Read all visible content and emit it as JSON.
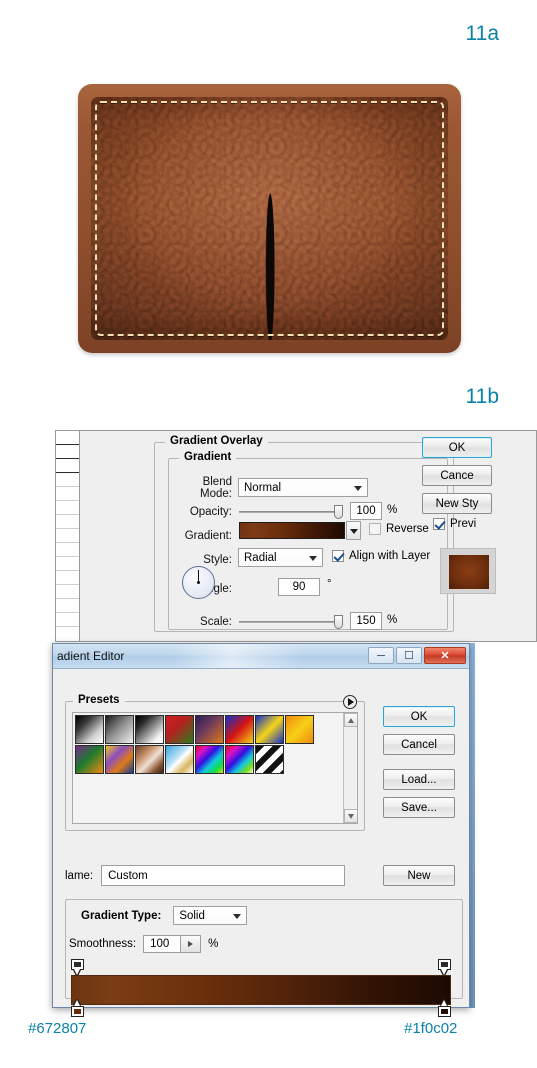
{
  "steps": {
    "a_label": "11a",
    "b_label": "11b"
  },
  "artwork": {
    "name": "leather-wallet-preview",
    "base_color": "#94502b",
    "stitch_color": "#efe1b4",
    "slot_color": "#0c0805"
  },
  "layer_style_dialog": {
    "section_title": "Gradient Overlay",
    "group_title": "Gradient",
    "blend_mode": {
      "label": "Blend Mode:",
      "value": "Normal"
    },
    "opacity": {
      "label": "Opacity:",
      "value": "100",
      "unit": "%"
    },
    "gradient": {
      "label": "Gradient:",
      "swatch_from": "#723312",
      "swatch_to": "#1d0b02"
    },
    "reverse": {
      "label": "Reverse",
      "checked": false
    },
    "style": {
      "label": "Style:",
      "value": "Radial"
    },
    "align_with_layer": {
      "label": "Align with Layer",
      "checked": true
    },
    "angle": {
      "label": "Angle:",
      "value": "90",
      "unit": "°"
    },
    "scale": {
      "label": "Scale:",
      "value": "150",
      "unit": "%"
    },
    "buttons": {
      "ok": "OK",
      "cancel": "Cance",
      "new_style": "New Sty"
    },
    "preview": {
      "label": "Previ",
      "checked": true
    }
  },
  "gradient_editor": {
    "title": "adient Editor",
    "window_buttons": {
      "minimize": "minimize-icon",
      "maximize": "maximize-icon",
      "close": "close-icon"
    },
    "presets": {
      "title": "Presets",
      "menu_icon": "preset-menu-icon",
      "items": [
        {
          "name": "foreground-to-background",
          "css": "linear-gradient(135deg,#000000 0%,#3a3a3a 30%,#d0d0d0 70%,#ffffff 100%)"
        },
        {
          "name": "foreground-to-transparent",
          "css": "linear-gradient(135deg,#1a1a1a 0%,#8a8a8a 45%,rgba(255,255,255,0) 100%)"
        },
        {
          "name": "black-white",
          "css": "linear-gradient(135deg,#000000 0%,#2a2a2a 25%,#f2f2f2 80%,#ffffff 100%)"
        },
        {
          "name": "red-green",
          "css": "linear-gradient(135deg,#d21f1f 0%,#b52020 40%,#2f7a1e 100%)"
        },
        {
          "name": "violet-orange",
          "css": "linear-gradient(135deg,#2b1d52 0%,#6b3a5e 40%,#e07a16 100%)"
        },
        {
          "name": "blue-red-yellow",
          "css": "linear-gradient(135deg,#1430c8 0%,#d41414 50%,#f5d417 100%)"
        },
        {
          "name": "blue-yellow-blue",
          "css": "linear-gradient(135deg,#1430c8 0%,#f5d417 50%,#1430c8 100%)"
        },
        {
          "name": "orange-yellow-orange",
          "css": "linear-gradient(135deg,#f08a10 0%,#f7d017 50%,#f08a10 100%)"
        },
        {
          "name": "violet-green-orange",
          "css": "linear-gradient(135deg,#7a2a8e 0%,#1d7a2e 45%,#f08a10 100%)"
        },
        {
          "name": "yellow-violet-orange-blue",
          "css": "linear-gradient(135deg,#f5c617 0%,#8b4fc0 35%,#e07a16 65%,#123a96 100%)"
        },
        {
          "name": "copper",
          "css": "linear-gradient(135deg,#6b4026 0%,#c08a63 30%,#f2e0d2 55%,#8a5533 80%,#3a2315 100%)"
        },
        {
          "name": "chrome",
          "css": "linear-gradient(135deg,#35a5e0 0%,#bfe4f7 42%,#ffffff 52%,#d8b55f 75%,#ffffff 100%)"
        },
        {
          "name": "spectrum",
          "css": "linear-gradient(135deg,#e01010 0%,#e010c8 20%,#3010e0 42%,#10c8e0 62%,#10e040 82%,#e0e010 100%)"
        },
        {
          "name": "transparent-rainbow",
          "css": "linear-gradient(135deg,#e01010 0%,#e010c8 22%,#3010e0 45%,#10c8e0 65%,#7ee010 85%,#ffffff 100%)"
        },
        {
          "name": "transparent-stripes",
          "css": "repeating-linear-gradient(135deg,#111111 0px,#111111 6px,#ffffff 6px,#ffffff 12px)"
        }
      ]
    },
    "buttons": {
      "ok": "OK",
      "cancel": "Cancel",
      "load": "Load...",
      "save": "Save...",
      "new": "New"
    },
    "name_field": {
      "label": "lame:",
      "value": "Custom"
    },
    "gradient_type": {
      "label": "Gradient Type:",
      "value": "Solid"
    },
    "smoothness": {
      "label": "Smoothness:",
      "value": "100",
      "unit": "%"
    },
    "gradient_bar": {
      "from": "#6d3510",
      "to": "#1c0a02",
      "opacity_stops": [
        {
          "position": 0,
          "color": "#2b2b2b"
        },
        {
          "position": 100,
          "color": "#2b2b2b"
        }
      ],
      "color_stops": [
        {
          "position": 0,
          "color": "#672807"
        },
        {
          "position": 100,
          "color": "#1f0c02"
        }
      ]
    }
  },
  "captions": {
    "left_hex": "#672807",
    "right_hex": "#1f0c02",
    "accent_color": "#0b83a8"
  }
}
